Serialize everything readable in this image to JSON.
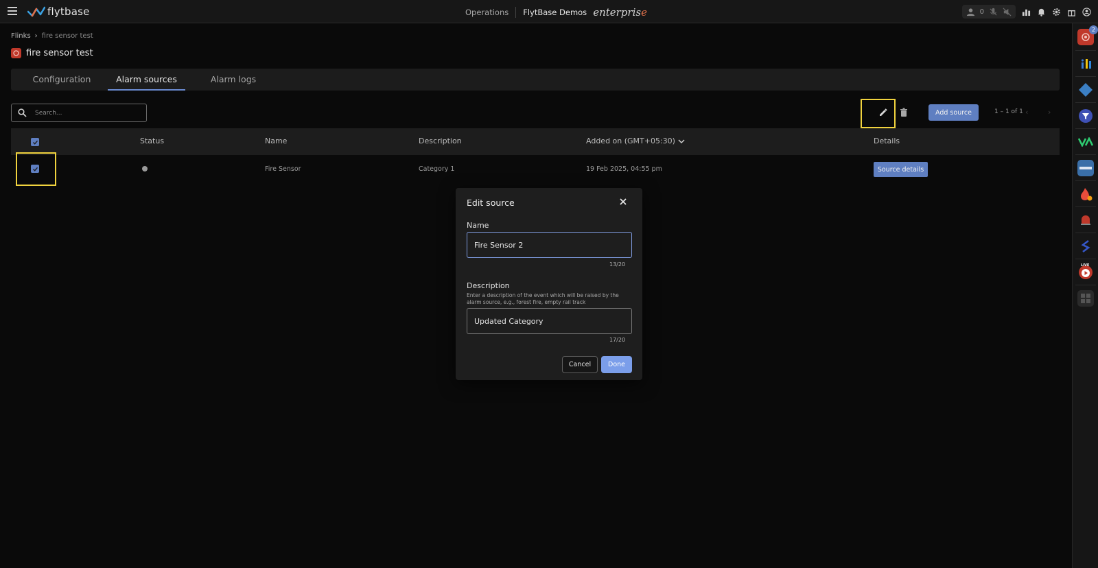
{
  "topbar": {
    "brand": "flytbase",
    "operations": "Operations",
    "org": "FlytBase Demos",
    "enterprise": "enterpris",
    "enterprise_accent": "e",
    "user_count": "0"
  },
  "rail": {
    "badge_count": "2",
    "live_label": "LIVE"
  },
  "breadcrumb": {
    "root": "Flinks",
    "separator": "›",
    "current": "fire sensor test"
  },
  "page": {
    "title": "fire sensor test"
  },
  "tabs": [
    {
      "label": "Configuration"
    },
    {
      "label": "Alarm sources"
    },
    {
      "label": "Alarm logs"
    }
  ],
  "toolbar": {
    "search_placeholder": "Search...",
    "add_source_label": "Add source",
    "pagination": "1 – 1 of 1"
  },
  "table": {
    "headers": {
      "status": "Status",
      "name": "Name",
      "description": "Description",
      "added_on": "Added on (GMT+05:30)",
      "details": "Details"
    },
    "rows": [
      {
        "name": "Fire Sensor",
        "description": "Category 1",
        "added_on": "19 Feb 2025, 04:55 pm",
        "details_label": "Source details"
      }
    ]
  },
  "modal": {
    "title": "Edit source",
    "name_label": "Name",
    "name_value": "Fire Sensor 2",
    "name_counter": "13/20",
    "description_label": "Description",
    "description_hint": "Enter a description of the event which will be raised by the alarm source, e.g., forest fire, empty rail track",
    "description_value": "Updated Category",
    "description_counter": "17/20",
    "cancel_label": "Cancel",
    "done_label": "Done"
  },
  "colors": {
    "accent": "#5f7fc1",
    "done_button": "#7b9eea",
    "highlight": "#f1d33e",
    "background": "#0a0a0a"
  },
  "icons": [
    "menu-icon",
    "search-icon",
    "pencil-icon",
    "trash-icon",
    "close-icon",
    "chevron-down-icon",
    "bell-icon",
    "gear-icon",
    "gift-icon",
    "user-circle-icon",
    "chart-icon"
  ]
}
